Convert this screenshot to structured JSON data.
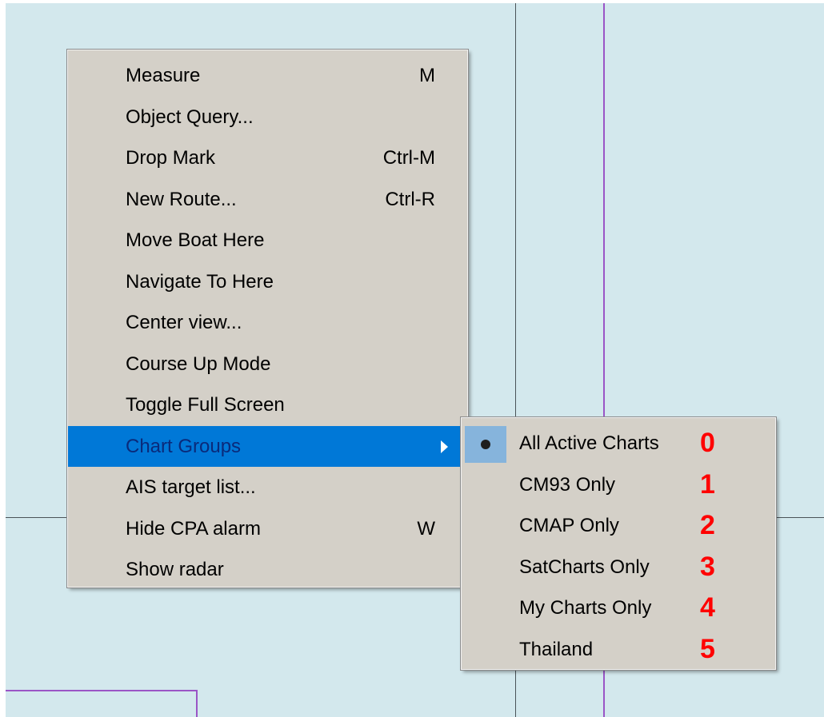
{
  "context_menu": {
    "items": [
      {
        "label": "Measure",
        "shortcut": "M"
      },
      {
        "label": "Object Query...",
        "shortcut": ""
      },
      {
        "label": "Drop Mark",
        "shortcut": "Ctrl-M"
      },
      {
        "label": "New Route...",
        "shortcut": "Ctrl-R"
      },
      {
        "label": "Move Boat Here",
        "shortcut": ""
      },
      {
        "label": "Navigate To Here",
        "shortcut": ""
      },
      {
        "label": "Center view...",
        "shortcut": ""
      },
      {
        "label": "Course Up Mode",
        "shortcut": ""
      },
      {
        "label": "Toggle Full Screen",
        "shortcut": ""
      },
      {
        "label": "Chart Groups",
        "shortcut": "",
        "submenu": true,
        "highlighted": true
      },
      {
        "label": "AIS target list...",
        "shortcut": ""
      },
      {
        "label": "Hide CPA alarm",
        "shortcut": "W"
      },
      {
        "label": "Show radar",
        "shortcut": ""
      }
    ]
  },
  "chart_groups_submenu": {
    "items": [
      {
        "label": "All Active Charts",
        "annotation": "0",
        "selected": true
      },
      {
        "label": "CM93 Only",
        "annotation": "1",
        "selected": false
      },
      {
        "label": "CMAP Only",
        "annotation": "2",
        "selected": false
      },
      {
        "label": "SatCharts Only",
        "annotation": "3",
        "selected": false
      },
      {
        "label": "My Charts Only",
        "annotation": "4",
        "selected": false
      },
      {
        "label": "Thailand",
        "annotation": "5",
        "selected": false
      }
    ]
  },
  "colors": {
    "chart_background": "#d3e8ed",
    "menu_background": "#d4d0c8",
    "highlight": "#0078d7",
    "selected_radio_bg": "#86b4dc",
    "annotation": "#ff0000",
    "boundary_line": "#9a55c6"
  }
}
